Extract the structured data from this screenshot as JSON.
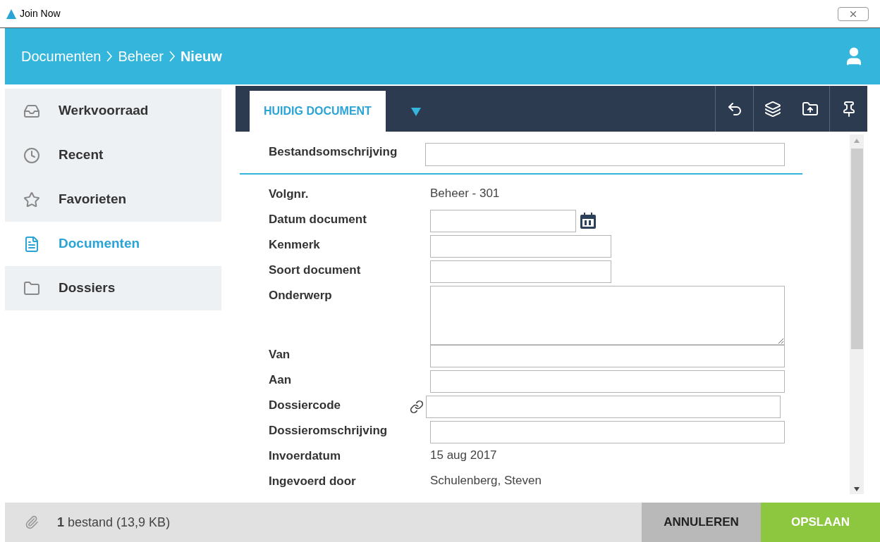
{
  "window": {
    "title": "Join Now"
  },
  "breadcrumb": [
    {
      "label": "Documenten",
      "current": false
    },
    {
      "label": "Beheer",
      "current": false
    },
    {
      "label": "Nieuw",
      "current": true
    }
  ],
  "sidebar": {
    "items": [
      {
        "label": "Werkvoorraad",
        "selected": false
      },
      {
        "label": "Recent",
        "selected": false
      },
      {
        "label": "Favorieten",
        "selected": false
      },
      {
        "label": "Documenten",
        "selected": true
      },
      {
        "label": "Dossiers",
        "selected": false
      }
    ]
  },
  "tabs": [
    {
      "label": "HUIDIG DOCUMENT",
      "selected": true
    }
  ],
  "form": {
    "header_field": {
      "label": "Bestandsomschrijving"
    },
    "fields": [
      {
        "label": "Volgnr.",
        "kind": "text",
        "value": "Beheer - 301"
      },
      {
        "label": "Datum document",
        "kind": "date"
      },
      {
        "label": "Kenmerk",
        "kind": "short-input"
      },
      {
        "label": "Soort document",
        "kind": "short-input"
      },
      {
        "label": "Onderwerp",
        "kind": "textarea"
      },
      {
        "label": "Van",
        "kind": "input"
      },
      {
        "label": "Aan",
        "kind": "input"
      },
      {
        "label": "Dossiercode",
        "kind": "linked-input"
      },
      {
        "label": "Dossieromschrijving",
        "kind": "input"
      },
      {
        "label": "Invoerdatum",
        "kind": "text",
        "value": "15 aug 2017"
      },
      {
        "label": "Ingevoerd door",
        "kind": "text",
        "value": "Schulenberg, Steven"
      }
    ]
  },
  "footer": {
    "count": "1",
    "attachment": "bestand (13,9 KB)",
    "buttons": [
      {
        "label": "ANNULEREN",
        "kind": "secondary"
      },
      {
        "label": "OPSLAAN",
        "kind": "primary"
      }
    ]
  }
}
